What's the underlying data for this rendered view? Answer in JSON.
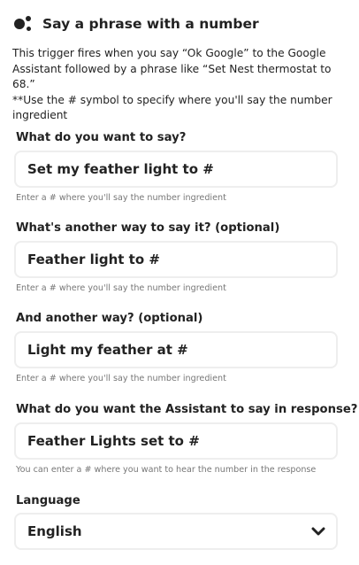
{
  "header": {
    "title": "Say a phrase with a number",
    "logo": "google-assistant-logo"
  },
  "description": {
    "line1": "This trigger fires when you say “Ok Google” to the Google Assistant followed by a phrase like “Set Nest thermostat to 68.”",
    "line2": "**Use the # symbol to specify where you'll say the number ingredient"
  },
  "fields": [
    {
      "label": "What do you want to say?",
      "value": "Set my feather light to #",
      "help": "Enter a # where you'll say the number ingredient"
    },
    {
      "label": "What's another way to say it? (optional)",
      "value": "Feather light to #",
      "help": "Enter a # where you'll say the number ingredient"
    },
    {
      "label": "And another way? (optional)",
      "value": "Light my feather at #",
      "help": "Enter a # where you'll say the number ingredient"
    },
    {
      "label": "What do you want the Assistant to say in response?",
      "value": "Feather Lights set to #",
      "help": "You can enter a # where you want to hear the number in the response"
    }
  ],
  "language": {
    "label": "Language",
    "selected": "English",
    "icon": "chevron-down-icon"
  },
  "colors": {
    "text": "#222222",
    "help_text": "#777777",
    "input_border": "#eeeeee"
  }
}
